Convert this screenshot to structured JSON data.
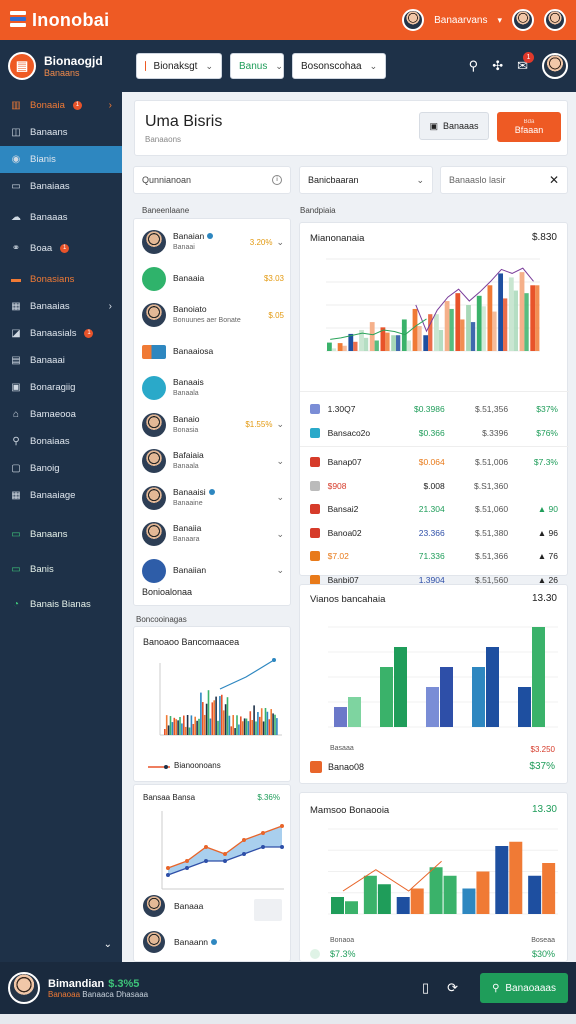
{
  "app": {
    "name": "Inonobai",
    "top_user": "Banaarvans",
    "top_caret": "▾"
  },
  "header": {
    "brand_title": "Bionaogjd",
    "brand_sub": "Banaans",
    "dropdowns": [
      "Bionaksgt",
      "Banus",
      "Bosonscohaa"
    ],
    "notif_count": "1"
  },
  "sidebar": {
    "items": [
      {
        "label": "Bonaaia",
        "icon": "chart-icon",
        "badge": "1",
        "arrow": "›",
        "style": "orange"
      },
      {
        "label": "Banaans",
        "icon": "layers-icon",
        "badge": "",
        "arrow": "",
        "style": ""
      },
      {
        "label": "Bianis",
        "icon": "circle-icon",
        "badge": "",
        "arrow": "",
        "style": "active"
      },
      {
        "label": "Banaiaas",
        "icon": "window-icon",
        "badge": "",
        "arrow": "",
        "style": ""
      },
      {
        "label": "Banaaas",
        "icon": "cloud-icon",
        "badge": "",
        "arrow": "",
        "style": ""
      },
      {
        "label": "Boaa",
        "icon": "link-icon",
        "badge": "1",
        "arrow": "",
        "style": ""
      },
      {
        "label": "Bonasians",
        "icon": "folder-icon",
        "badge": "",
        "arrow": "",
        "style": "orange"
      },
      {
        "label": "Banaaias",
        "icon": "grid-icon",
        "badge": "",
        "arrow": "›",
        "style": ""
      },
      {
        "label": "Banaasials",
        "icon": "chart-line-icon",
        "badge": "1",
        "arrow": "",
        "style": ""
      },
      {
        "label": "Banaaai",
        "icon": "doc-icon",
        "badge": "",
        "arrow": "",
        "style": ""
      },
      {
        "label": "Bonaragiig",
        "icon": "table-icon",
        "badge": "",
        "arrow": "",
        "style": ""
      },
      {
        "label": "Bamaeooa",
        "icon": "tag-icon",
        "badge": "",
        "arrow": "",
        "style": ""
      },
      {
        "label": "Bonaiaas",
        "icon": "pin-icon",
        "badge": "",
        "arrow": "",
        "style": ""
      },
      {
        "label": "Banoig",
        "icon": "calendar-icon",
        "badge": "",
        "arrow": "",
        "style": ""
      },
      {
        "label": "Banaaiage",
        "icon": "grid2-icon",
        "badge": "",
        "arrow": "",
        "style": ""
      }
    ],
    "bottom_items": [
      {
        "label": "Banaans",
        "icon": "monitor-icon"
      },
      {
        "label": "Banis",
        "icon": "monitor2-icon"
      },
      {
        "label": "Banais Bianas",
        "icon": "gauge-icon"
      }
    ],
    "scroll_arrow": "⌄"
  },
  "title_card": {
    "title": "Uma Bisris",
    "subtitle": "Banaaons",
    "button1": "Banaaas",
    "button2_small": "Bda",
    "button2": "Bfaaan"
  },
  "filters": {
    "search": "Qunnianoan",
    "select": "Banicbaaran",
    "search2": "Banaaslo lasir"
  },
  "list": {
    "section": "Baneenlaane",
    "items": [
      {
        "name": "Banaian",
        "sub": "Banaai",
        "value": "3.20%",
        "kind": "person",
        "extra": "chevron"
      },
      {
        "name": "Banaaia",
        "sub": "",
        "value": "$3.03",
        "kind": "green",
        "extra": ""
      },
      {
        "name": "Banoiato",
        "sub": "Bonuunes aer Bonate",
        "value": "$.05",
        "kind": "person",
        "extra": ""
      },
      {
        "name": "Banaaiosa",
        "sub": "",
        "value": "",
        "kind": "box",
        "extra": ""
      },
      {
        "name": "Banaais",
        "sub": "Banaala",
        "value": "",
        "kind": "teal",
        "extra": ""
      },
      {
        "name": "Banaio",
        "sub": "Bonasia",
        "value": "$1.55%",
        "kind": "person",
        "extra": "chevron"
      },
      {
        "name": "Bafaiaia",
        "sub": "Banaala",
        "value": "",
        "kind": "person",
        "extra": "chevron"
      },
      {
        "name": "Banaaisi",
        "sub": "Banaaine",
        "value": "",
        "kind": "person",
        "extra": "chevron"
      },
      {
        "name": "Banaiia",
        "sub": "Banaara",
        "value": "",
        "kind": "person",
        "extra": "chevron"
      },
      {
        "name": "Banaiian",
        "sub": "",
        "value": "",
        "kind": "blue",
        "extra": "chevron"
      }
    ],
    "footer": "Bonioalonaa"
  },
  "small_left_chart": {
    "section": "Boncooinagas",
    "title": "Banoaoo Bancomaacea",
    "legend": "Bianoonoans"
  },
  "small_line_chart": {
    "title": "Bansaa Bansa",
    "value": "$.36%",
    "row1": "Banaaa",
    "row2": "Banaann"
  },
  "main_chart": {
    "section": "Bandpiaia",
    "title": "Mianonanaia",
    "value": "$.830"
  },
  "table": [
    {
      "icon_color": "#7a8dd6",
      "c1": "1.30Q7",
      "c1c": "k",
      "c2": "$0.3986",
      "c2c": "g",
      "c3": "$.51,356",
      "c4": "$37%",
      "c4c": "g"
    },
    {
      "icon_color": "#2aa9c9",
      "c1": "Bansaco2o",
      "c1c": "k",
      "c2": "$0.366",
      "c2c": "g",
      "c3": "$.3396",
      "c4": "$76%",
      "c4c": "g"
    },
    {
      "icon_color": "#d63b2a",
      "c1": "Banap07",
      "c1c": "k",
      "c2": "$0.064",
      "c2c": "o",
      "c3": "$.51,006",
      "c4": "$7.3%",
      "c4c": "g"
    },
    {
      "icon_color": "#bbbbbb",
      "c1": "$908",
      "c1c": "r",
      "c2": "$.008",
      "c2c": "k",
      "c3": "$.S1,360",
      "c4": "",
      "c4c": "k"
    },
    {
      "icon_color": "#d63b2a",
      "c1": "Bansai2",
      "c1c": "k",
      "c2": "21.304",
      "c2c": "g",
      "c3": "$.51,060",
      "c4": "▲ 90",
      "c4c": "g"
    },
    {
      "icon_color": "#d63b2a",
      "c1": "Banoa02",
      "c1c": "k",
      "c2": "23.366",
      "c2c": "b",
      "c3": "$.51,380",
      "c4": "▲ 96",
      "c4c": "k"
    },
    {
      "icon_color": "#e87a1a",
      "c1": "$7.02",
      "c1c": "o",
      "c2": "71.336",
      "c2c": "g",
      "c3": "$.51,366",
      "c4": "▲ 76",
      "c4c": "k"
    },
    {
      "icon_color": "#e87a1a",
      "c1": "Banbi07",
      "c1c": "k",
      "c2": "1.3904",
      "c2c": "b",
      "c3": "$.51,560",
      "c4": "▲ 26",
      "c4c": "k"
    }
  ],
  "bar_chart": {
    "title": "Vianos bancahaia",
    "value": "13.30",
    "foot_label": "Basaaa",
    "foot_value_red": "$3.250",
    "row_label": "Banao08",
    "row_value": "$37%"
  },
  "bar_chart2": {
    "title": "Mamsoo Bonaooia",
    "value": "13.30",
    "foot_left": "Bonaoa",
    "foot_right": "Boseaa",
    "foot_value": "$7.3%",
    "foot_value2": "$30%"
  },
  "footer": {
    "name": "Bimandian",
    "name_value": "$.3%5",
    "sub": "Banaoaa",
    "sub2": "Banaaca Dhasaaa",
    "button": "Banaoaaas"
  },
  "colors": {
    "accent": "#ee5a24",
    "navy": "#1e3148",
    "green": "#1f9d5a",
    "blue": "#2e87c0"
  },
  "chart_data": [
    {
      "type": "bar",
      "title": "Mianonanaia",
      "ylim": [
        0,
        350
      ],
      "series": [
        {
          "values": [
            32,
            30,
            65,
            80,
            110,
            90,
            60,
            120,
            160,
            60,
            140,
            190,
            220,
            175,
            210,
            250,
            295,
            280,
            300,
            250
          ]
        },
        {
          "values": [
            10,
            20,
            35,
            50,
            40,
            70,
            60,
            40,
            95,
            140,
            80,
            160,
            120,
            110,
            170,
            150,
            200,
            230,
            220,
            250
          ]
        }
      ]
    },
    {
      "type": "bar",
      "title": "Vianos bancahaia",
      "ylim": [
        0,
        100
      ],
      "series": [
        {
          "values": [
            20,
            60,
            40,
            60,
            40
          ]
        },
        {
          "values": [
            30,
            80,
            60,
            80,
            100
          ]
        }
      ]
    },
    {
      "type": "bar",
      "title": "Mamsoo Bonaooia",
      "ylim": [
        0,
        100
      ],
      "series": [
        {
          "values": [
            20,
            45,
            20,
            55,
            30,
            80,
            45
          ]
        },
        {
          "values": [
            15,
            35,
            30,
            45,
            50,
            85,
            60
          ]
        }
      ]
    },
    {
      "type": "line",
      "title": "Bansaa Bansa",
      "ylim": [
        0,
        10
      ],
      "series": [
        {
          "values": [
            3,
            4,
            6,
            5,
            7,
            8,
            9
          ]
        },
        {
          "values": [
            2,
            3,
            4,
            4,
            5,
            6,
            6
          ]
        }
      ]
    }
  ]
}
